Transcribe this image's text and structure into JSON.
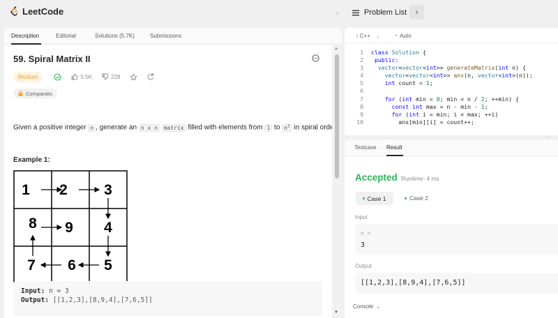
{
  "header": {
    "app_name": "LeetCode",
    "problem_list_label": "Problem List",
    "prev_icon": "chevron-left-icon",
    "next_icon": "chevron-right-icon"
  },
  "left_tabs": {
    "description": "Description",
    "editorial": "Editorial",
    "solutions": "Solutions (5.7K)",
    "submissions": "Submissions"
  },
  "problem": {
    "title": "59. Spiral Matrix II",
    "difficulty": "Medium",
    "likes": "5.5K",
    "dislikes": "228",
    "companies_label": "Companies",
    "desc_before": "Given a positive integer ",
    "desc_n": "n",
    "desc_mid": ", generate an ",
    "desc_nxn": "n x n",
    "desc_matrix": "matrix",
    "desc_after": " filled with elements from ",
    "desc_one": "1",
    "desc_to": " to ",
    "desc_n2": "n",
    "desc_sup": "2",
    "desc_end": " in spiral order."
  },
  "example": {
    "title": "Example 1:",
    "grid": [
      [
        "1",
        "2",
        "3"
      ],
      [
        "8",
        "9",
        "4"
      ],
      [
        "7",
        "6",
        "5"
      ]
    ],
    "input_label": "Input:",
    "input_value": "n = 3",
    "output_label": "Output:",
    "output_value": "[[1,2,3],[8,9,4],[7,6,5]]"
  },
  "editor": {
    "language": "C++",
    "mode": "Auto"
  },
  "result": {
    "tab_testcase": "Testcase",
    "tab_result": "Result",
    "status": "Accepted",
    "runtime": "Runtime: 4 ms",
    "case1": "Case 1",
    "case2": "Case 2",
    "input_label": "Input",
    "input_name": "n =",
    "input_value": "3",
    "output_label": "Output",
    "output_value": "[[1,2,3],[8,9,4],[7,6,5]]",
    "console_label": "Console"
  },
  "colors": {
    "accepted": "#2db55d",
    "medium": "#e6a23c",
    "brand": "#ffa116"
  }
}
